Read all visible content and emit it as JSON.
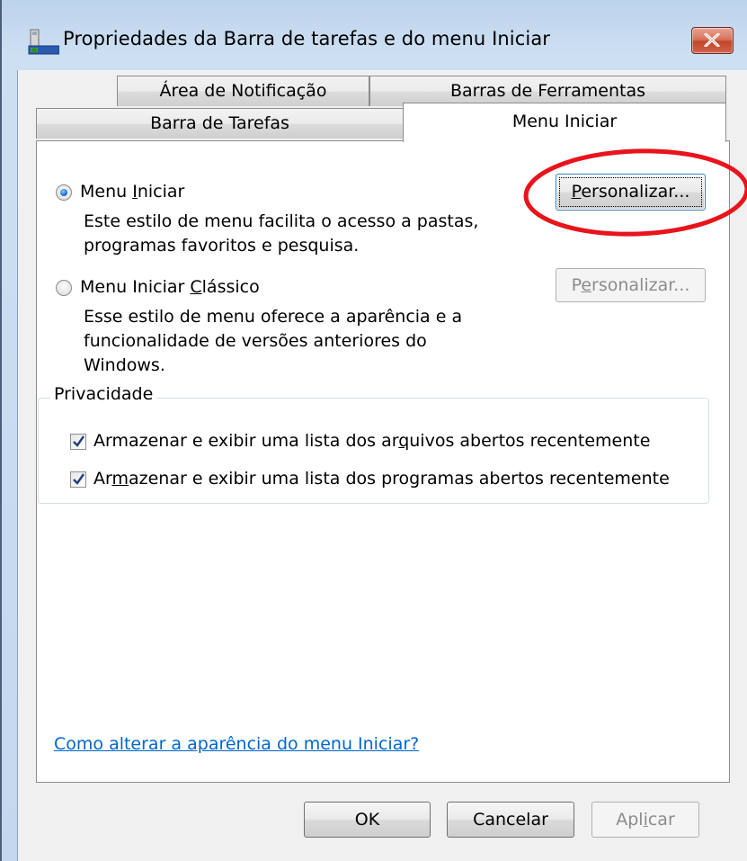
{
  "window": {
    "title": "Propriedades da Barra de tarefas e do menu Iniciar",
    "close_icon": "close-x"
  },
  "tabs": {
    "back_row": [
      {
        "label": "Área de Notificação"
      },
      {
        "label": "Barras de Ferramentas"
      }
    ],
    "front_row": [
      {
        "label": "Barra de Tarefas"
      },
      {
        "label": "Menu Iniciar",
        "selected": true
      }
    ]
  },
  "start_menu": {
    "option": {
      "label_pre": "Menu ",
      "label_key": "I",
      "label_post": "niciar",
      "selected": true,
      "description": [
        "Este estilo de menu facilita o acesso a pastas,",
        "programas favoritos e pesquisa."
      ],
      "button": {
        "pre": "",
        "key": "P",
        "post": "ersonalizar...",
        "enabled": true
      }
    },
    "classic_option": {
      "label_pre": "Menu Iniciar ",
      "label_key": "C",
      "label_post": "lássico",
      "selected": false,
      "description": [
        "Esse estilo de menu oferece a aparência e  a",
        "funcionalidade de versões anteriores do",
        "Windows."
      ],
      "button": {
        "pre": "P",
        "key": "e",
        "post": "rsonalizar...",
        "enabled": false
      }
    }
  },
  "privacy": {
    "legend": "Privacidade",
    "items": [
      {
        "pre": "Armazenar e exibir uma lista dos ar",
        "key": "q",
        "post": "uivos abertos recentemente",
        "checked": true
      },
      {
        "pre": "Ar",
        "key": "m",
        "post": "azenar e exibir uma lista dos programas abertos recentemente",
        "checked": true
      }
    ]
  },
  "help_link": "Como alterar a aparência do menu Iniciar?",
  "footer": {
    "ok": "OK",
    "cancel": "Cancelar",
    "apply": {
      "pre": "Apl",
      "key": "i",
      "post": "car",
      "enabled": false
    }
  },
  "colors": {
    "annotation_circle": "#e8141c",
    "link": "#0066cc",
    "radio_dot": "#1d6fd0"
  }
}
